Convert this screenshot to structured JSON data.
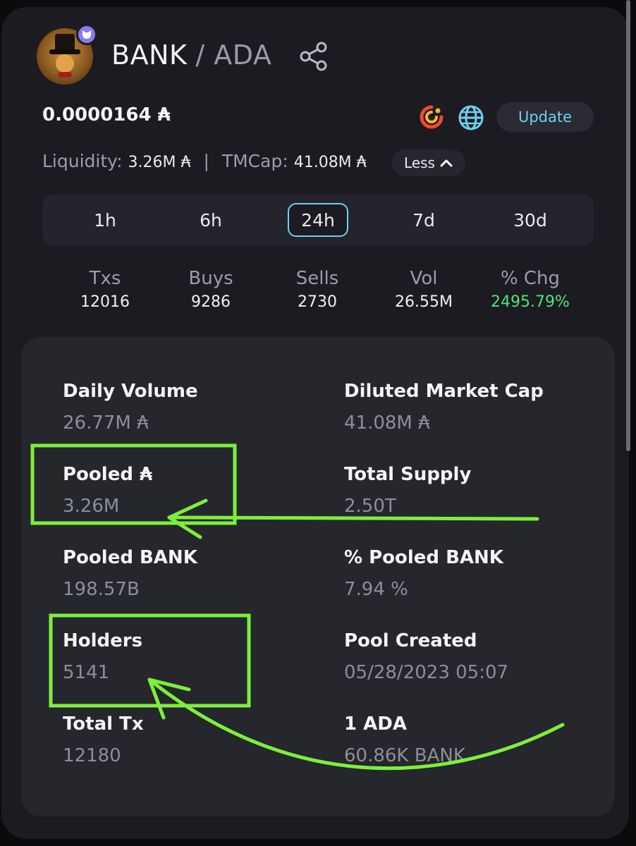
{
  "header": {
    "base_token": "BANK",
    "quote_token": "/ ADA"
  },
  "price": "0.0000164 ₳",
  "buttons": {
    "update": "Update",
    "less": "Less"
  },
  "summary": {
    "liquidity_label": "Liquidity:",
    "liquidity_value": "3.26M ₳",
    "tmcap_label": "TMCap:",
    "tmcap_value": "41.08M ₳",
    "separator": "|"
  },
  "tabs": [
    "1h",
    "6h",
    "24h",
    "7d",
    "30d"
  ],
  "active_tab": "24h",
  "metrics": [
    {
      "label": "Txs",
      "value": "12016"
    },
    {
      "label": "Buys",
      "value": "9286"
    },
    {
      "label": "Sells",
      "value": "2730"
    },
    {
      "label": "Vol",
      "value": "26.55M"
    },
    {
      "label": "% Chg",
      "value": "2495.79%"
    }
  ],
  "details": [
    {
      "label": "Daily Volume",
      "value": "26.77M ₳"
    },
    {
      "label": "Diluted Market Cap",
      "value": "41.08M ₳"
    },
    {
      "label": "Pooled ₳",
      "value": "3.26M"
    },
    {
      "label": "Total Supply",
      "value": "2.50T"
    },
    {
      "label": "Pooled BANK",
      "value": "198.57B"
    },
    {
      "label": "% Pooled BANK",
      "value": "7.94 %"
    },
    {
      "label": "Holders",
      "value": "5141"
    },
    {
      "label": "Pool Created",
      "value": "05/28/2023 05:07"
    },
    {
      "label": "Total Tx",
      "value": "12180"
    },
    {
      "label": "1 ADA",
      "value": "60.86K BANK"
    }
  ],
  "colors": {
    "accent": "#6fd0ee",
    "positive": "#4ee27a",
    "annotation": "#7cf03a"
  },
  "icons": [
    "share-icon",
    "token-logo-icon",
    "globe-icon",
    "chevron-up-icon",
    "badge-icon"
  ]
}
